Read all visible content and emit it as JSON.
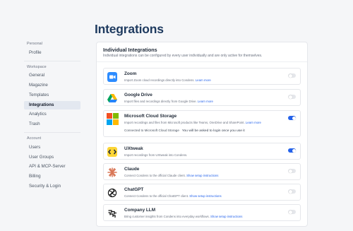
{
  "sidebar": {
    "sections": [
      {
        "heading": "Personal",
        "items": [
          {
            "label": "Profile"
          }
        ]
      },
      {
        "heading": "Workspace",
        "items": [
          {
            "label": "General"
          },
          {
            "label": "Magazine"
          },
          {
            "label": "Templates"
          },
          {
            "label": "Integrations"
          },
          {
            "label": "Analytics"
          },
          {
            "label": "Trash"
          }
        ]
      },
      {
        "heading": "Account",
        "items": [
          {
            "label": "Users"
          },
          {
            "label": "User Groups"
          },
          {
            "label": "API & MCP-Server"
          },
          {
            "label": "Billing"
          },
          {
            "label": "Security & Login"
          }
        ]
      }
    ],
    "active_item": "Integrations"
  },
  "main": {
    "title": "Integrations",
    "card": {
      "title": "Individual Integrations",
      "subtitle": "Individual integrations can be configured by every user individually and are only active for themselves."
    },
    "integrations": [
      {
        "name": "Zoom",
        "description": "Import Zoom cloud recordings directly into Condens.",
        "link": "Learn more",
        "enabled": false,
        "icon": "zoom-icon"
      },
      {
        "name": "Google Drive",
        "description": "Import files and recordings directly from Google Drive.",
        "link": "Learn more",
        "enabled": false,
        "icon": "google-drive-icon"
      },
      {
        "name": "Microsoft Cloud Storage",
        "description": "Import recordings and files from Microsoft products like Teams, OneDrive and SharePoint.",
        "link": "Learn more",
        "enabled": true,
        "icon": "microsoft-icon",
        "status": "Connected to Microsoft Cloud Storage",
        "status_note": "You will be asked to login once you use it"
      },
      {
        "name": "UXtweak",
        "description": "Import recordings from UXtweak into Condens.",
        "link": "",
        "enabled": true,
        "icon": "uxtweak-icon"
      },
      {
        "name": "Claude",
        "description": "Connect Condens to the official Claude client.",
        "link": "Show setup instructions",
        "enabled": false,
        "icon": "claude-icon"
      },
      {
        "name": "ChatGPT",
        "description": "Connect Condens to the official ChatGPT client.",
        "link": "Show setup instructions",
        "enabled": false,
        "icon": "chatgpt-icon"
      },
      {
        "name": "Company LLM",
        "description": "Bring customer insights from Condens into everyday workflows.",
        "link": "Show setup instructions",
        "enabled": false,
        "icon": "company-llm-icon"
      }
    ]
  },
  "colors": {
    "accent": "#2563eb",
    "zoom": "#2d8cff",
    "microsoft_red": "#f25022",
    "microsoft_green": "#7fba00",
    "microsoft_blue": "#00a4ef",
    "microsoft_yellow": "#ffb900",
    "uxtweak_yellow": "#fcd535",
    "claude": "#d97757"
  }
}
